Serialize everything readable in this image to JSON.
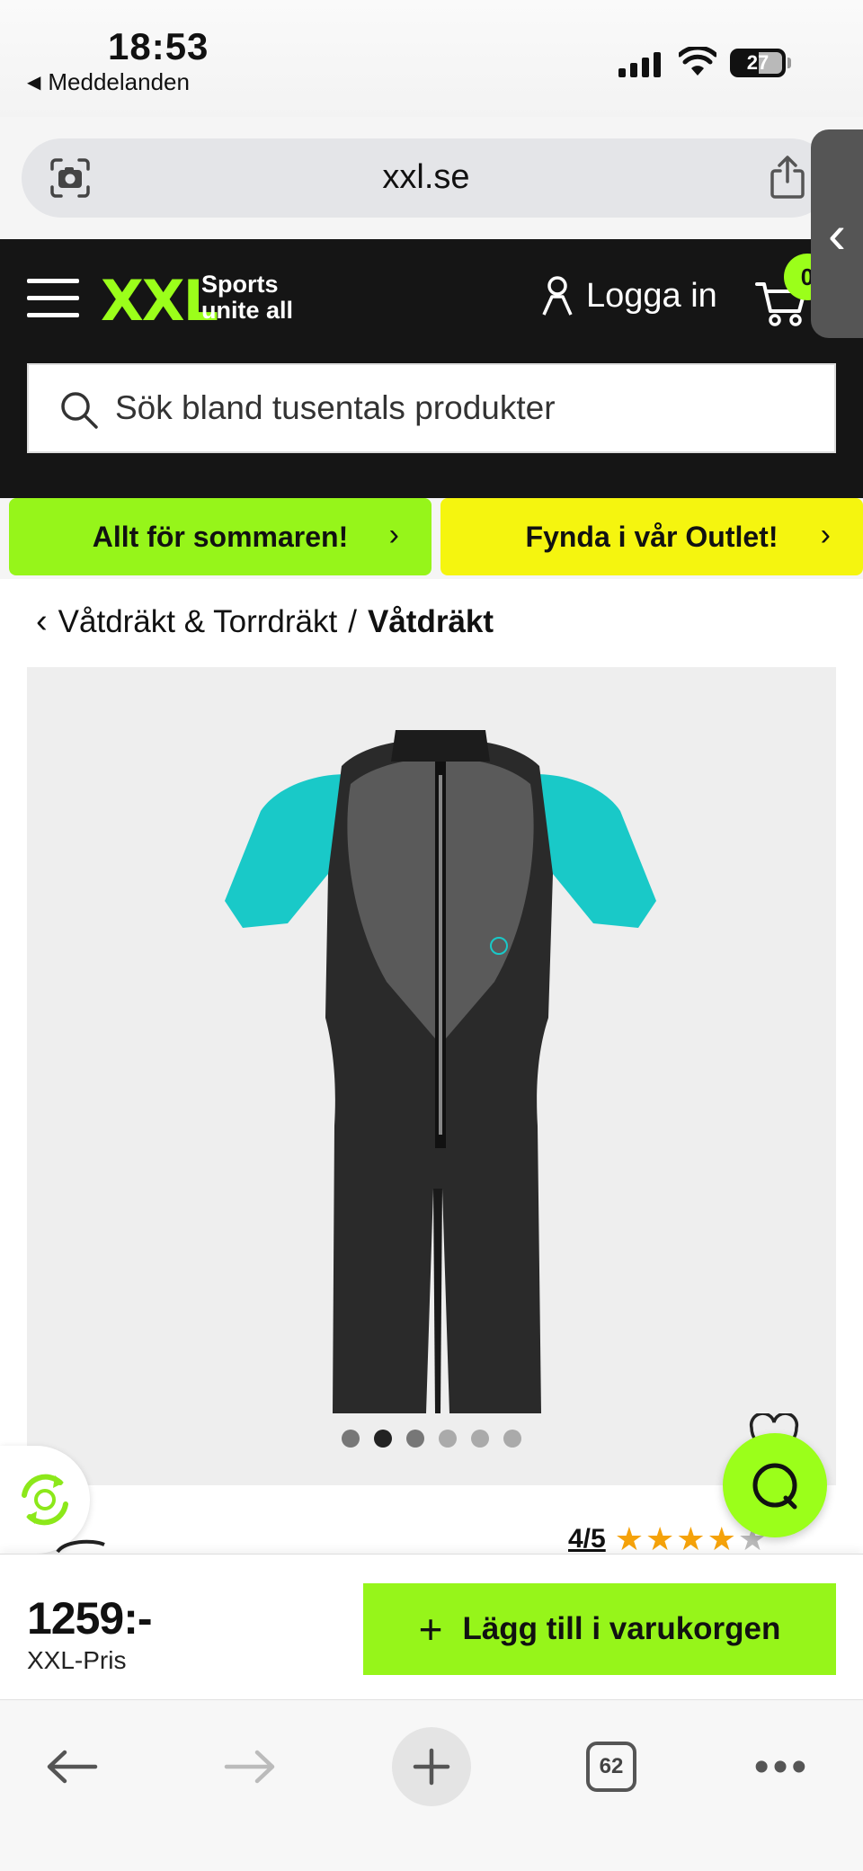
{
  "status_bar": {
    "time": "18:53",
    "back_app": "Meddelanden",
    "battery": "27"
  },
  "browser": {
    "url": "xxl.se",
    "tab_count": "62"
  },
  "header": {
    "logo": "XXL",
    "tagline_line1": "Sports",
    "tagline_line2": "unite all",
    "login_label": "Logga in",
    "cart_count": "0",
    "search_placeholder": "Sök bland tusentals produkter"
  },
  "promos": {
    "left": "Allt för sommaren!",
    "right": "Fynda i vår Outlet!"
  },
  "breadcrumb": {
    "parent": "Våtdräkt & Torrdräkt",
    "separator": "/",
    "current": "Våtdräkt"
  },
  "gallery": {
    "image_count": 6,
    "active_index": 1
  },
  "product": {
    "rating_text": "4/5",
    "rating_value": 4,
    "rating_max": 5,
    "price": "1259:-",
    "price_label": "XXL-Pris",
    "add_to_cart_label": "Lägg till i varukorgen"
  },
  "colors": {
    "brand_green": "#96f51a",
    "outlet_yellow": "#f5f50f",
    "header_black": "#151515",
    "star_orange": "#f5a20a"
  },
  "icons": {
    "search": "search-icon",
    "user": "user-icon",
    "cart": "cart-icon",
    "heart": "heart-icon",
    "chat": "chat-icon",
    "share": "share-icon"
  }
}
